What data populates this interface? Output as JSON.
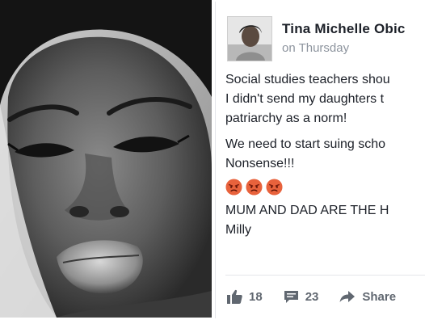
{
  "post": {
    "author": "Tina Michelle Obic",
    "timestamp": "on Thursday",
    "lines": {
      "l1": "Social studies teachers shou",
      "l2": "I didn't send my daughters t",
      "l3": "patriarchy as a norm!",
      "l4": "We need to start suing scho",
      "l5": "Nonsense!!!",
      "l6": "MUM AND DAD ARE THE H",
      "l7": "Milly"
    },
    "emoji": [
      "angry-face",
      "angry-face",
      "angry-face"
    ],
    "actions": {
      "likes": "18",
      "comments": "23",
      "share": "Share"
    }
  },
  "colors": {
    "text": "#1d2129",
    "meta": "#8d949e",
    "action": "#606770",
    "emoji": "#e8623c"
  },
  "icons": {
    "like": "thumbs-up-icon",
    "comment": "comment-icon",
    "share": "share-arrow-icon"
  }
}
